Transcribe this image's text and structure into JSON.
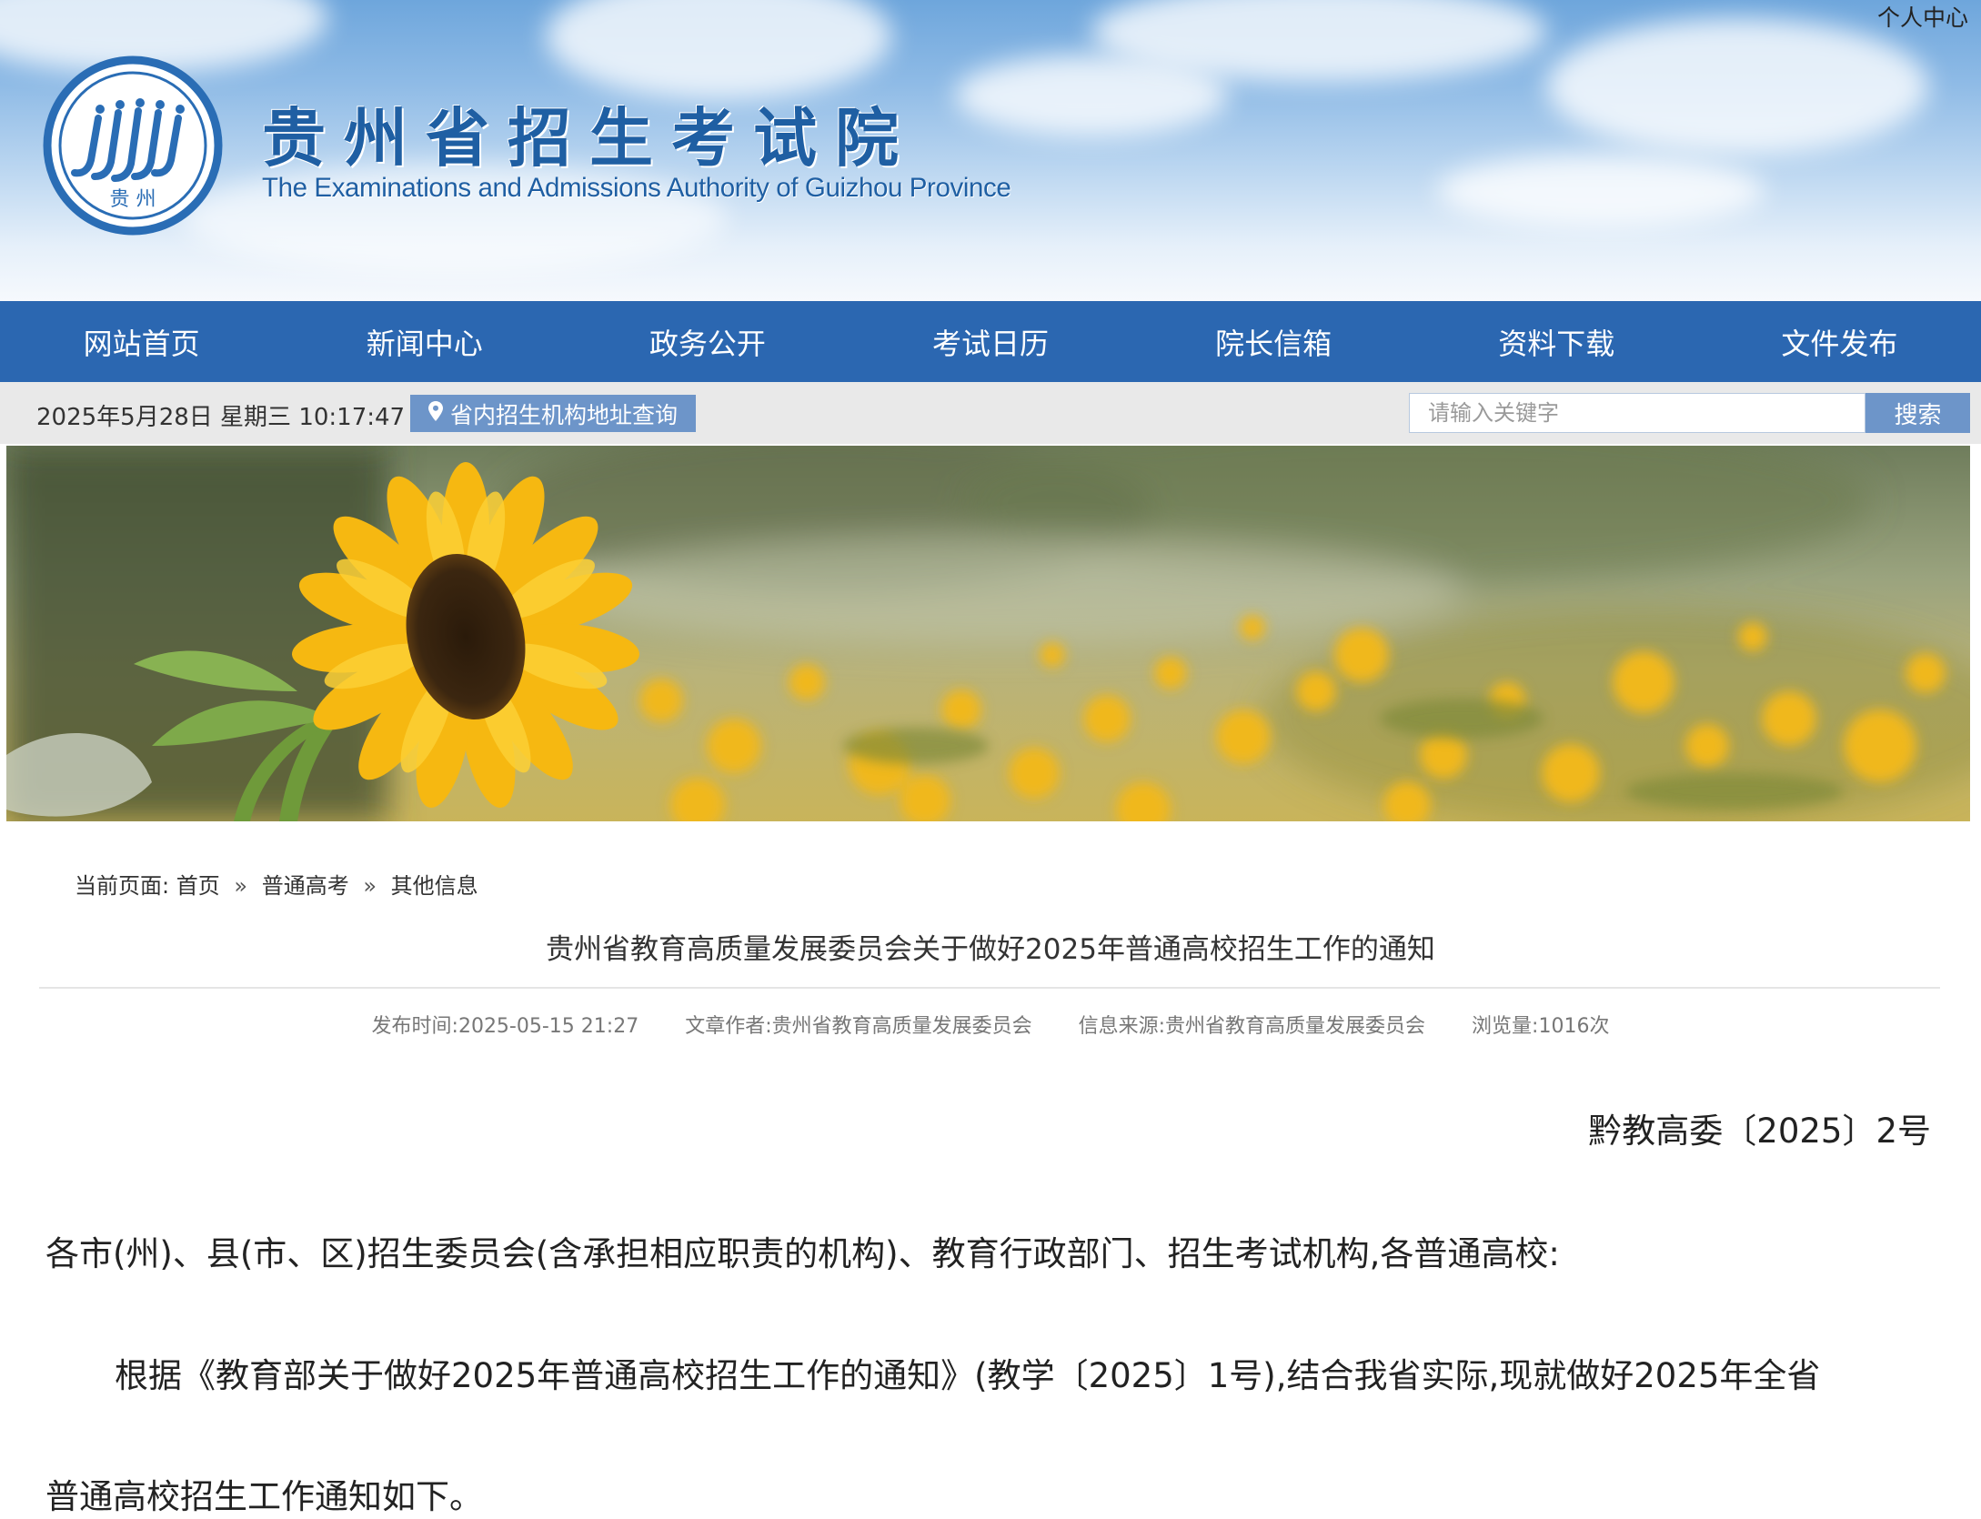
{
  "header": {
    "personal_center": "个人中心",
    "logo_text": "贵 州",
    "title_cn": "贵州省招生考试院",
    "title_en": "The Examinations and Admissions Authority of Guizhou Province"
  },
  "nav": {
    "items": [
      {
        "label": "网站首页"
      },
      {
        "label": "新闻中心"
      },
      {
        "label": "政务公开"
      },
      {
        "label": "考试日历"
      },
      {
        "label": "院长信箱"
      },
      {
        "label": "资料下载"
      },
      {
        "label": "文件发布"
      }
    ]
  },
  "infobar": {
    "datetime": "2025年5月28日 星期三 10:17:47",
    "address_query": "省内招生机构地址查询",
    "search_placeholder": "请输入关键字",
    "search_button": "搜索"
  },
  "breadcrumb": {
    "prefix": "当前页面:",
    "items": [
      "首页",
      "普通高考",
      "其他信息"
    ],
    "separator": "»"
  },
  "article": {
    "title": "贵州省教育高质量发展委员会关于做好2025年普通高校招生工作的通知",
    "meta": {
      "publish_time": "发布时间:2025-05-15 21:27",
      "author": "文章作者:贵州省教育高质量发展委员会",
      "source": "信息来源:贵州省教育高质量发展委员会",
      "views": "浏览量:1016次"
    },
    "doc_number": "黔教高委〔2025〕2号",
    "salutation": "各市(州)、县(市、区)招生委员会(含承担相应职责的机构)、教育行政部门、招生考试机构,各普通高校:",
    "body_line_1": "根据《教育部关于做好2025年普通高校招生工作的通知》(教学〔2025〕1号),结合我省实际,现就做好2025年全省",
    "body_line_2": "普通高校招生工作通知如下。"
  },
  "colors": {
    "nav_bg": "#2b67b1",
    "button_bg": "#6d95c9",
    "title_blue": "#1f5fa3",
    "infobar_bg": "#e9e9e9"
  }
}
